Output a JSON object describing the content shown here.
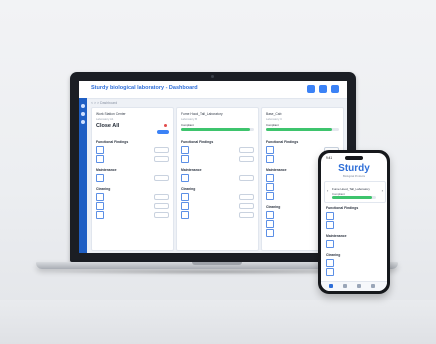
{
  "app": {
    "title": "Sturdy biological laboratory - Dashboard",
    "breadcrumb": "< > > Dashboard"
  },
  "columns": [
    {
      "name": "Work Station Center",
      "subtitle": "Laboratory A1",
      "count": "Close All"
    },
    {
      "name": "Fume Hood_Tall_Laboratory",
      "subtitle": "Laboratory B",
      "status": "Compliant",
      "progress": 0.95
    },
    {
      "name": "Base_Cab",
      "subtitle": "Laboratory C",
      "status": "Compliant",
      "progress": 0.9
    }
  ],
  "sections": {
    "functional": "Functional Findings",
    "maintenance": "Maintenance",
    "cleaning": "Cleaning"
  },
  "phone": {
    "time": "9:41",
    "logo": "Sturdy",
    "logo_sub": "Biological Products",
    "card_title": "Fume Hood_Tall_Laboratory",
    "status": "Compliant",
    "progress": 0.92
  },
  "colors": {
    "accent": "#2f6fd8",
    "sidebar": "#1f5fc4",
    "progress": "#3ec46d"
  }
}
